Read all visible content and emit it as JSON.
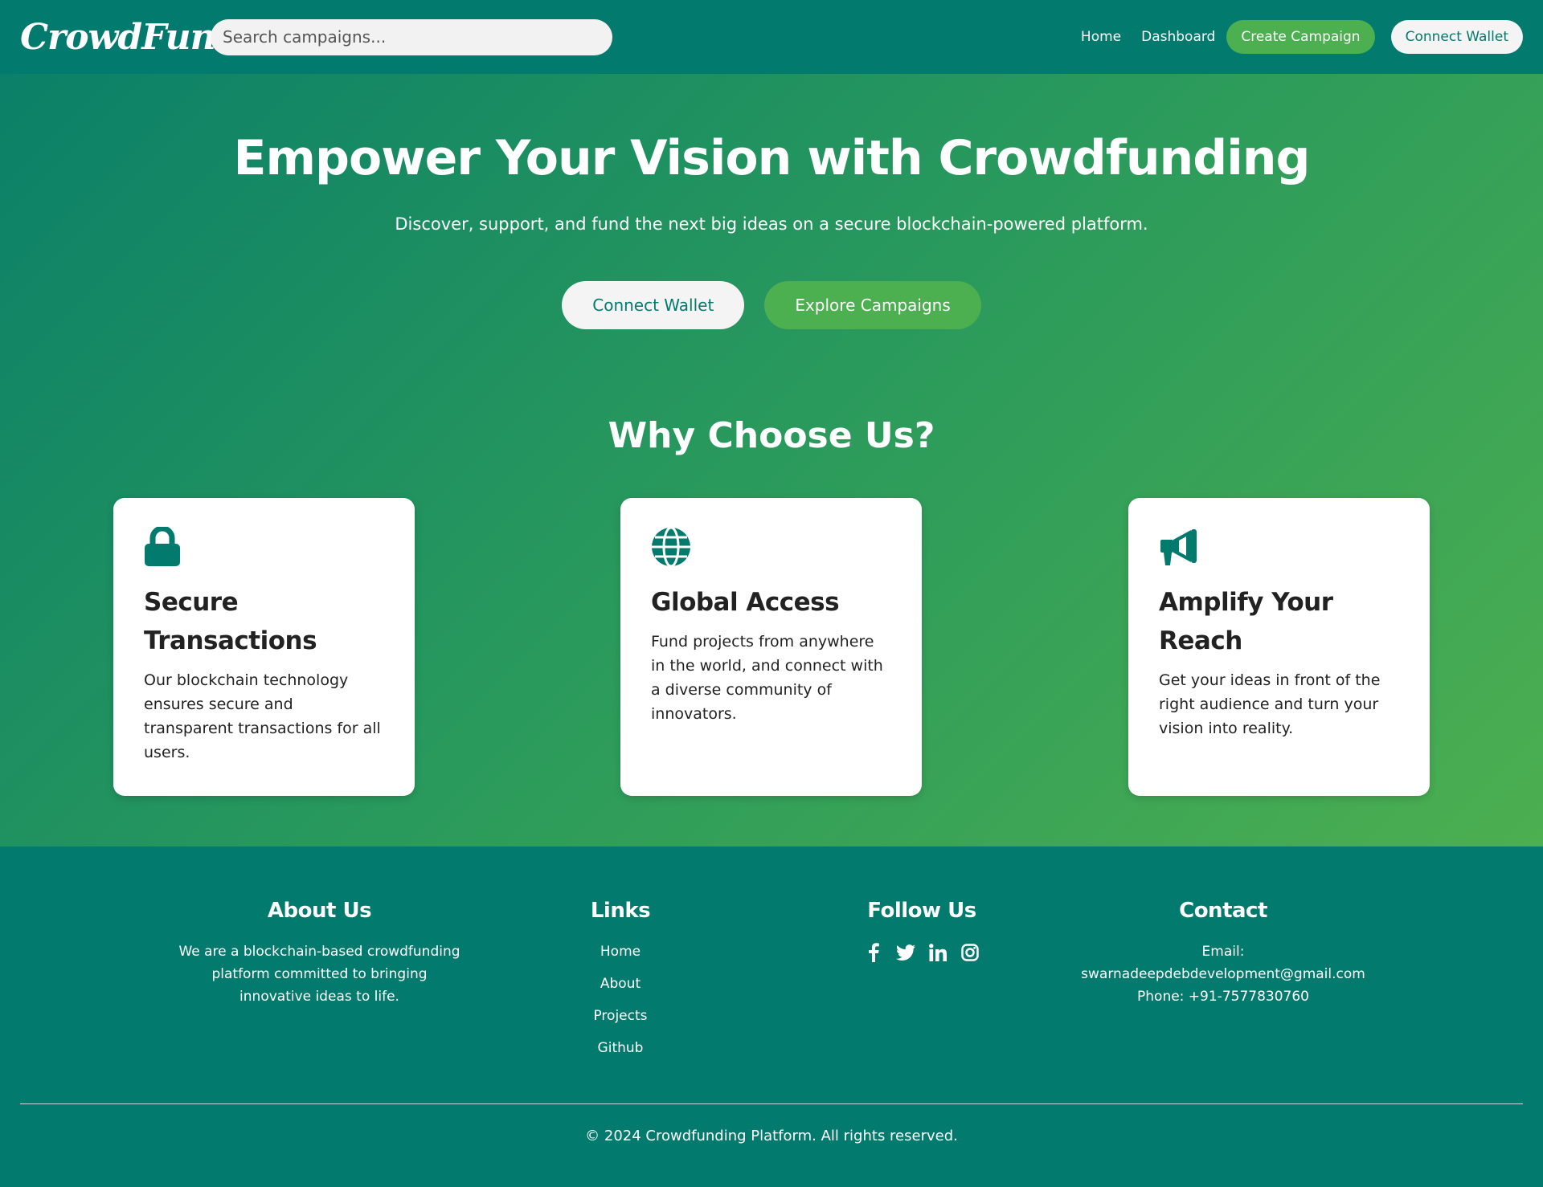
{
  "navbar": {
    "logo": "CrowdFund",
    "search_placeholder": "Search campaigns...",
    "links": [
      "Home",
      "Dashboard"
    ],
    "create_label": "Create Campaign",
    "connect_label": "Connect Wallet"
  },
  "hero": {
    "title": "Empower Your Vision with Crowdfunding",
    "subtitle": "Discover, support, and fund the next big ideas on a secure blockchain-powered platform.",
    "connect_label": "Connect Wallet",
    "explore_label": "Explore Campaigns"
  },
  "why": {
    "title": "Why Choose Us?",
    "cards": [
      {
        "icon": "lock-icon",
        "title": "Secure Transactions",
        "desc": "Our blockchain technology ensures secure and transparent transactions for all users."
      },
      {
        "icon": "globe-icon",
        "title": "Global Access",
        "desc": "Fund projects from anywhere in the world, and connect with a diverse community of innovators."
      },
      {
        "icon": "megaphone-icon",
        "title": "Amplify Your Reach",
        "desc": "Get your ideas in front of the right audience and turn your vision into reality."
      }
    ]
  },
  "footer": {
    "about": {
      "title": "About Us",
      "text": "We are a blockchain-based crowdfunding platform committed to bringing innovative ideas to life."
    },
    "links": {
      "title": "Links",
      "items": [
        "Home",
        "About",
        "Projects",
        "Github"
      ]
    },
    "follow": {
      "title": "Follow Us",
      "icons": [
        "facebook-icon",
        "twitter-icon",
        "linkedin-icon",
        "instagram-icon"
      ]
    },
    "contact": {
      "title": "Contact",
      "email_label": "Email:",
      "email": "swarnadeepdebdevelopment@gmail.com",
      "phone": "Phone: +91-7577830760"
    },
    "copyright": "© 2024 Crowdfunding Platform. All rights reserved."
  },
  "colors": {
    "primary": "#027a6e",
    "accent": "#4caf50",
    "light": "#f4f4f4"
  }
}
